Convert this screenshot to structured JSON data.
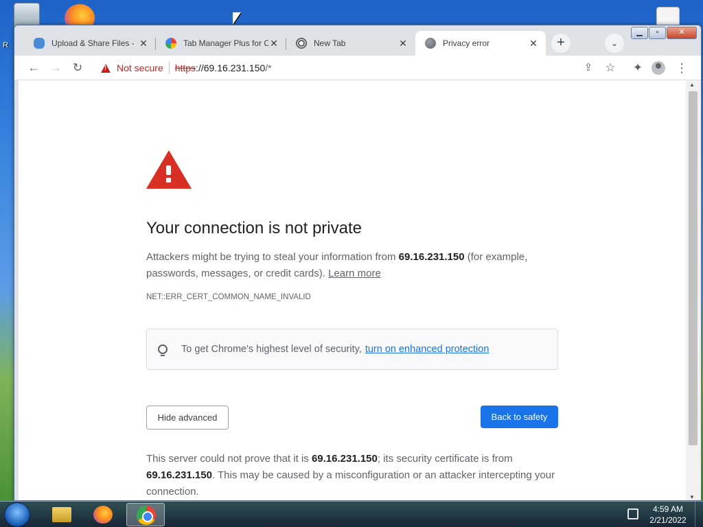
{
  "desktop": {
    "left_label": "R",
    "right_label": ""
  },
  "browser": {
    "tabs": [
      {
        "title": "Upload & Share Files - ",
        "favicon": "cloud-upload-icon",
        "active": false
      },
      {
        "title": "Tab Manager Plus for C",
        "favicon": "tab-manager-icon",
        "active": false
      },
      {
        "title": "New Tab",
        "favicon": "chrome-icon",
        "active": false
      },
      {
        "title": "Privacy error",
        "favicon": "globe-icon",
        "active": true
      }
    ],
    "close_glyph": "✕",
    "new_tab_glyph": "+",
    "tab_search_glyph": "⌄",
    "window_controls": {
      "minimize": "▁",
      "maximize": "▫",
      "close": "✕"
    },
    "toolbar": {
      "back_glyph": "←",
      "forward_glyph": "→",
      "reload_glyph": "↻",
      "security_label": "Not secure",
      "url_scheme": "https",
      "url_host": "://69.16.231.150",
      "url_path": "/*",
      "share_glyph": "⇪",
      "bookmark_glyph": "☆",
      "extensions_glyph": "✦",
      "menu_glyph": "⋮"
    }
  },
  "page": {
    "heading": "Your connection is not private",
    "intro_prefix": "Attackers might be trying to steal your information from ",
    "host": "69.16.231.150",
    "intro_suffix": " (for example, passwords, messages, or credit cards). ",
    "learn_more": "Learn more",
    "error_code": "NET::ERR_CERT_COMMON_NAME_INVALID",
    "enhanced_prefix": "To get Chrome's highest level of security,",
    "enhanced_link": "turn on enhanced protection",
    "hide_advanced": "Hide advanced",
    "back_to_safety": "Back to safety",
    "detail_prefix": "This server could not prove that it is ",
    "detail_host_1": "69.16.231.150",
    "detail_mid": "; its security certificate is from ",
    "detail_host_2": "69.16.231.150",
    "detail_suffix": ". This may be caused by a misconfiguration or an attacker intercepting your connection."
  },
  "taskbar": {
    "time": "4:59 AM",
    "date": "2/21/2022"
  },
  "colors": {
    "accent_blue": "#1a73e8",
    "danger_red": "#d93025",
    "not_secure_red": "#c5221f"
  }
}
